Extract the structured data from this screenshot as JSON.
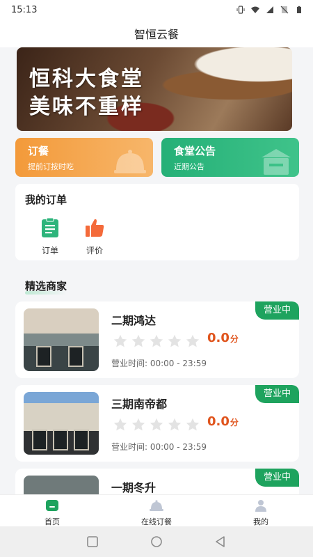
{
  "status_bar": {
    "time": "15:13"
  },
  "app": {
    "title": "智恒云餐"
  },
  "banner": {
    "line1": "恒科大食堂",
    "line2": "美味不重样"
  },
  "quick_actions": [
    {
      "title": "订餐",
      "subtitle": "提前订按时吃",
      "color": "#f39a3a"
    },
    {
      "title": "食堂公告",
      "subtitle": "近期公告",
      "color": "#25b077"
    }
  ],
  "my_orders": {
    "title": "我的订单",
    "items": [
      {
        "label": "订单",
        "icon": "clipboard-icon"
      },
      {
        "label": "评价",
        "icon": "thumbs-up-icon"
      }
    ]
  },
  "merchants": {
    "title": "精选商家",
    "list": [
      {
        "name": "二期鸿达",
        "rating": "0.0",
        "rating_unit": "分",
        "hours": "营业时间: 00:00 - 23:59",
        "status": "营业中"
      },
      {
        "name": "三期南帝都",
        "rating": "0.0",
        "rating_unit": "分",
        "hours": "营业时间: 00:00 - 23:59",
        "status": "营业中"
      },
      {
        "name": "一期冬升",
        "rating": "",
        "rating_unit": "",
        "hours": "",
        "status": "营业中"
      }
    ]
  },
  "tab_bar": [
    {
      "label": "首页",
      "icon": "home-icon",
      "active": true
    },
    {
      "label": "在线订餐",
      "icon": "cloche-icon",
      "active": false
    },
    {
      "label": "我的",
      "icon": "user-icon",
      "active": false
    }
  ],
  "colors": {
    "green": "#1ea35e",
    "orange": "#f39a3a",
    "score": "#e0551e"
  }
}
